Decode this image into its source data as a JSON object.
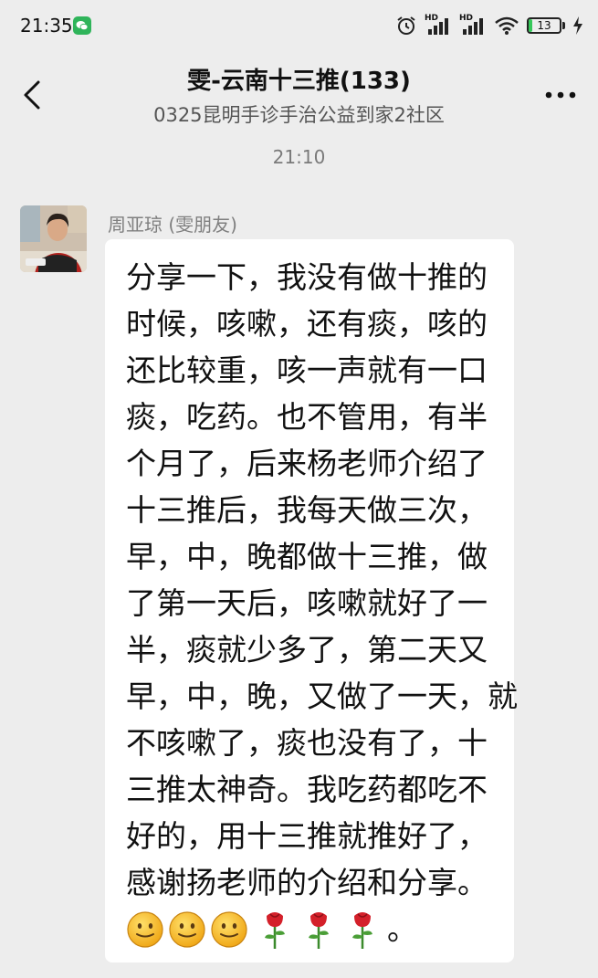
{
  "status_bar": {
    "time": "21:35",
    "battery": "13",
    "app_badge_icon": "wechat-icon",
    "icons": [
      "alarm-icon",
      "hd-signal-icon",
      "hd-signal-icon",
      "wifi-icon",
      "battery-icon",
      "charging-icon"
    ]
  },
  "header": {
    "title": "雯-云南十三推(133)",
    "subtitle": "0325昆明手诊手治公益到家2社区",
    "back_icon": "chevron-left-icon",
    "more_icon": "more-dots-icon"
  },
  "chat": {
    "timestamp": "21:10",
    "message": {
      "sender": "周亚琼 (雯朋友)",
      "lines": [
        "分享一下，我没有做十推的",
        "时候，咳嗽，还有痰，咳的",
        "还比较重，咳一声就有一口",
        "痰，吃药。也不管用，有半",
        "个月了，后来杨老师介绍了",
        "十三推后，我每天做三次，",
        "早，中，晚都做十三推，做",
        "了第一天后，咳嗽就好了一",
        "半，痰就少多了，第二天又",
        "早，中，晚，又做了一天，就",
        "不咳嗽了，痰也没有了，十",
        "三推太神奇。我吃药都吃不",
        "好的，用十三推就推好了，",
        "感谢扬老师的介绍和分享。"
      ],
      "emojis": [
        "smiley-icon",
        "smiley-icon",
        "smiley-icon",
        "rose-icon",
        "rose-icon",
        "rose-icon"
      ],
      "trailing": "。"
    }
  },
  "colors": {
    "background": "#ededed",
    "bubble": "#ffffff",
    "battery_green": "#35c759",
    "wechat_green": "#2fb45a"
  }
}
